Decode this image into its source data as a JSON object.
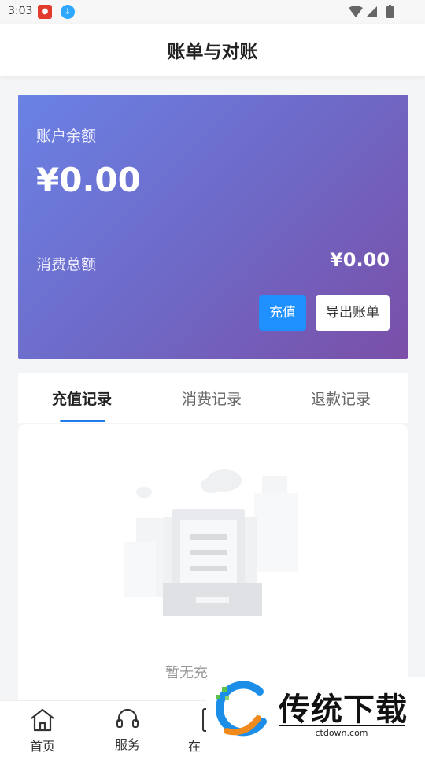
{
  "status": {
    "time": "3:03"
  },
  "header": {
    "title": "账单与对账"
  },
  "balance_card": {
    "balance_label": "账户余额",
    "balance_amount": "¥0.00",
    "consumption_label": "消费总额",
    "consumption_amount": "¥0.00",
    "recharge_button": "充值",
    "export_button": "导出账单"
  },
  "tabs": [
    {
      "label": "充值记录",
      "active": true
    },
    {
      "label": "消费记录",
      "active": false
    },
    {
      "label": "退款记录",
      "active": false
    }
  ],
  "empty_state": {
    "text": "暂无充"
  },
  "bottom_nav": [
    {
      "label": "首页",
      "icon": "home-icon"
    },
    {
      "label": "服务",
      "icon": "headset-icon"
    },
    {
      "label": "在",
      "icon": "phone-icon"
    }
  ],
  "watermark": {
    "brand": "传统下载",
    "url": "ctdown.com"
  },
  "colors": {
    "accent": "#1e90ff",
    "card_gradient_start": "#6a82e5",
    "card_gradient_end": "#7a4fa8"
  }
}
